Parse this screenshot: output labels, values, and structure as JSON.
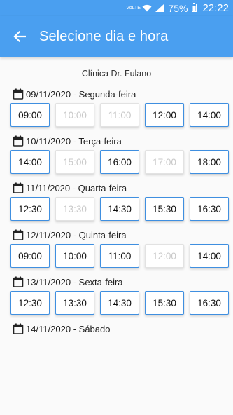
{
  "status_bar": {
    "network": "VoLTE",
    "battery": "75%",
    "time": "22:22"
  },
  "app_bar": {
    "title": "Selecione dia e hora"
  },
  "clinic_name": "Clínica Dr. Fulano",
  "days": [
    {
      "label": "09/11/2020 - Segunda-feira",
      "slots": [
        {
          "time": "09:00",
          "available": true
        },
        {
          "time": "10:00",
          "available": false
        },
        {
          "time": "11:00",
          "available": false
        },
        {
          "time": "12:00",
          "available": true
        },
        {
          "time": "14:00",
          "available": true
        }
      ]
    },
    {
      "label": "10/11/2020 - Terça-feira",
      "slots": [
        {
          "time": "14:00",
          "available": true
        },
        {
          "time": "15:00",
          "available": false
        },
        {
          "time": "16:00",
          "available": true
        },
        {
          "time": "17:00",
          "available": false
        },
        {
          "time": "18:00",
          "available": true
        }
      ]
    },
    {
      "label": "11/11/2020 - Quarta-feira",
      "slots": [
        {
          "time": "12:30",
          "available": true
        },
        {
          "time": "13:30",
          "available": false
        },
        {
          "time": "14:30",
          "available": true
        },
        {
          "time": "15:30",
          "available": true
        },
        {
          "time": "16:30",
          "available": true
        }
      ]
    },
    {
      "label": "12/11/2020 - Quinta-feira",
      "slots": [
        {
          "time": "09:00",
          "available": true
        },
        {
          "time": "10:00",
          "available": true
        },
        {
          "time": "11:00",
          "available": true
        },
        {
          "time": "12:00",
          "available": false
        },
        {
          "time": "14:00",
          "available": true
        }
      ]
    },
    {
      "label": "13/11/2020 - Sexta-feira",
      "slots": [
        {
          "time": "12:30",
          "available": true
        },
        {
          "time": "13:30",
          "available": true
        },
        {
          "time": "14:30",
          "available": true
        },
        {
          "time": "15:30",
          "available": true
        },
        {
          "time": "16:30",
          "available": true
        }
      ]
    },
    {
      "label": "14/11/2020 - Sábado",
      "slots": []
    }
  ],
  "colors": {
    "primary": "#4a9ff0",
    "slot_border": "#3f8fe0",
    "disabled_text": "#c9c9c9"
  },
  "icons": {
    "back": "arrow-left-icon",
    "day": "calendar-icon"
  }
}
